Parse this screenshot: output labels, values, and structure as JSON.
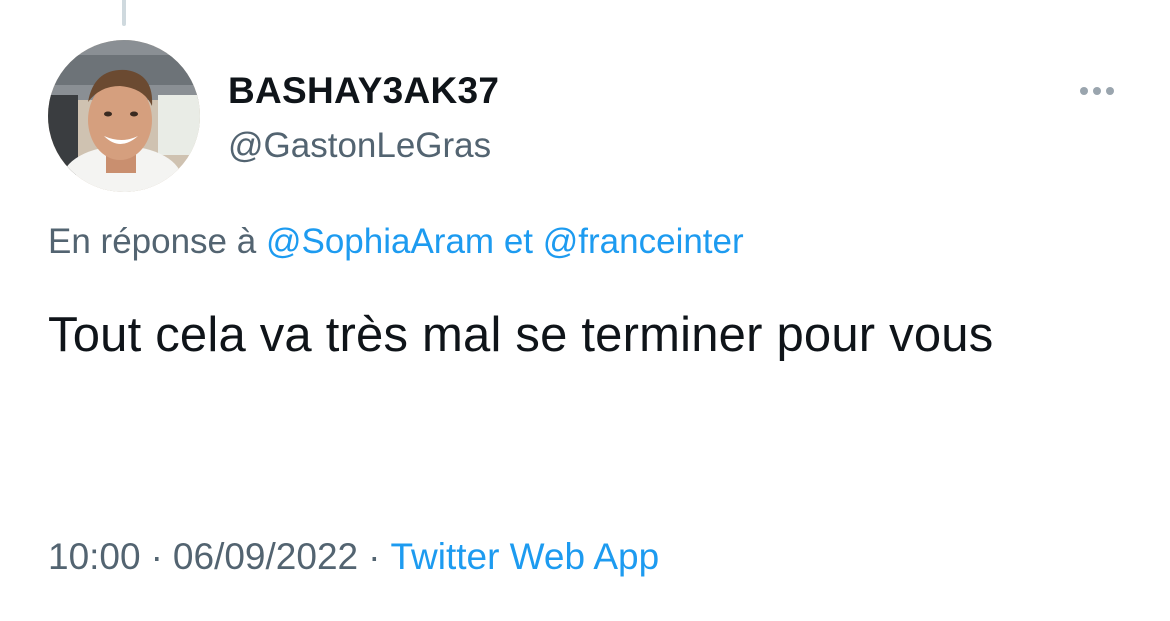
{
  "tweet": {
    "author": {
      "display_name": "BASHAY3AK37",
      "handle": "@GastonLeGras",
      "avatar": "profile-photo"
    },
    "reply_context": {
      "prefix": "En réponse à",
      "mentions": [
        "@SophiaAram",
        "@franceinter"
      ],
      "conjunction": "et"
    },
    "text": "Tout cela va très mal se terminer pour vous",
    "meta": {
      "time": "10:00",
      "date": "06/09/2022",
      "separator": "·",
      "source": "Twitter Web App"
    },
    "more_icon": "more-horizontal-icon"
  },
  "colors": {
    "text": "#0f1419",
    "secondary": "#536471",
    "link": "#1d9bf0",
    "thread_line": "#cfd9de"
  }
}
